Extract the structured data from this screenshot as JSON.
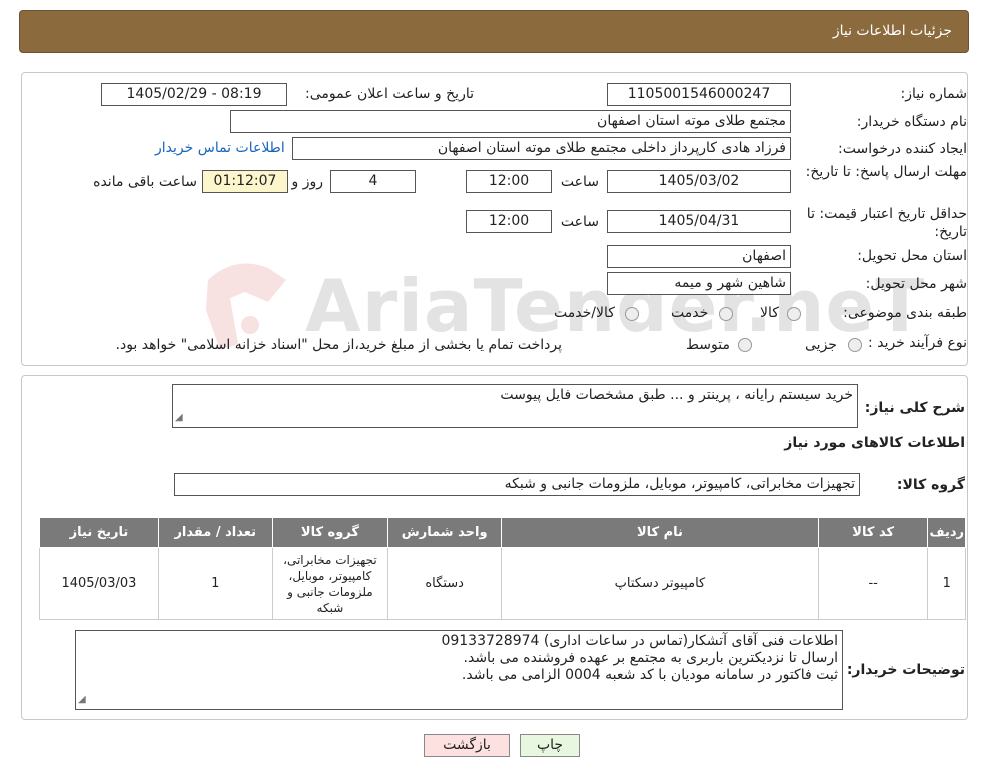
{
  "header": {
    "title": "جزئیات اطلاعات نیاز"
  },
  "form": {
    "need_number_label": "شماره نیاز:",
    "need_number_value": "1105001546000247",
    "announce_label": "تاریخ و ساعت اعلان عمومی:",
    "announce_value": "1405/02/29 - 08:19",
    "buyer_org_label": "نام دستگاه خریدار:",
    "buyer_org_value": "مجتمع طلای موته استان اصفهان",
    "creator_label": "ایجاد کننده درخواست:",
    "creator_value": "فرزاد هادی کارپرداز داخلی مجتمع طلای موته استان اصفهان",
    "contact_link": "اطلاعات تماس خریدار",
    "deadline_label": "مهلت ارسال پاسخ: تا تاریخ:",
    "deadline_date": "1405/03/02",
    "time_label": "ساعت",
    "deadline_time": "12:00",
    "days_value": "4",
    "days_label": "روز و",
    "remaining_time": "01:12:07",
    "remaining_label": "ساعت باقی مانده",
    "validity_label": "حداقل تاریخ اعتبار قیمت: تا تاریخ:",
    "validity_date": "1405/04/31",
    "validity_time": "12:00",
    "province_label": "استان محل تحویل:",
    "province_value": "اصفهان",
    "city_label": "شهر محل تحویل:",
    "city_value": "شاهین شهر و میمه",
    "category_label": "طبقه بندی موضوعی:",
    "category_options": [
      "کالا",
      "خدمت",
      "کالا/خدمت"
    ],
    "process_label": "نوع فرآیند خرید :",
    "process_options": [
      "جزیی",
      "متوسط"
    ],
    "process_note": "پرداخت تمام یا بخشی از مبلغ خرید،از محل \"اسناد خزانه اسلامی\" خواهد بود."
  },
  "summary": {
    "label": "شرح کلی نیاز:",
    "value": "خرید سیستم رایانه ، پرینتر و ... طبق مشخصات فایل پیوست",
    "items_title": "اطلاعات کالاهای مورد نیاز",
    "group_label": "گروه کالا:",
    "group_value": "تجهیزات مخابراتی، کامپیوتر، موبایل، ملزومات جانبی و شبکه"
  },
  "table": {
    "headers": [
      "ردیف",
      "کد کالا",
      "نام کالا",
      "واحد شمارش",
      "گروه کالا",
      "تعداد / مقدار",
      "تاریخ نیاز"
    ],
    "rows": [
      [
        "1",
        "--",
        "کامپیوتر دسکتاپ",
        "دستگاه",
        "تجهیزات مخابراتی، کامپیوتر، موبایل، ملزومات جانبی و شبکه",
        "1",
        "1405/03/03"
      ]
    ]
  },
  "buyer_notes": {
    "label": "توضیحات خریدار:",
    "lines": [
      "اطلاعات فنی آقای آتشکار(تماس در ساعات اداری) 09133728974",
      "ارسال تا نزدیکترین باربری به مجتمع بر عهده فروشنده می باشد.",
      "ثبت فاکتور در سامانه مودیان با کد شعبه 0004 الزامی می باشد."
    ]
  },
  "buttons": {
    "print": "چاپ",
    "back": "بازگشت"
  },
  "watermark": {
    "text": "AriaTender.neT"
  },
  "colors": {
    "header_bg": "#8b6a3e",
    "table_header_bg": "#7a7a7a",
    "remaining_bg": "#fdf6cc",
    "back_button_bg": "#fde0e0",
    "print_button_bg": "#e8f8e0",
    "link": "#1565c0"
  }
}
